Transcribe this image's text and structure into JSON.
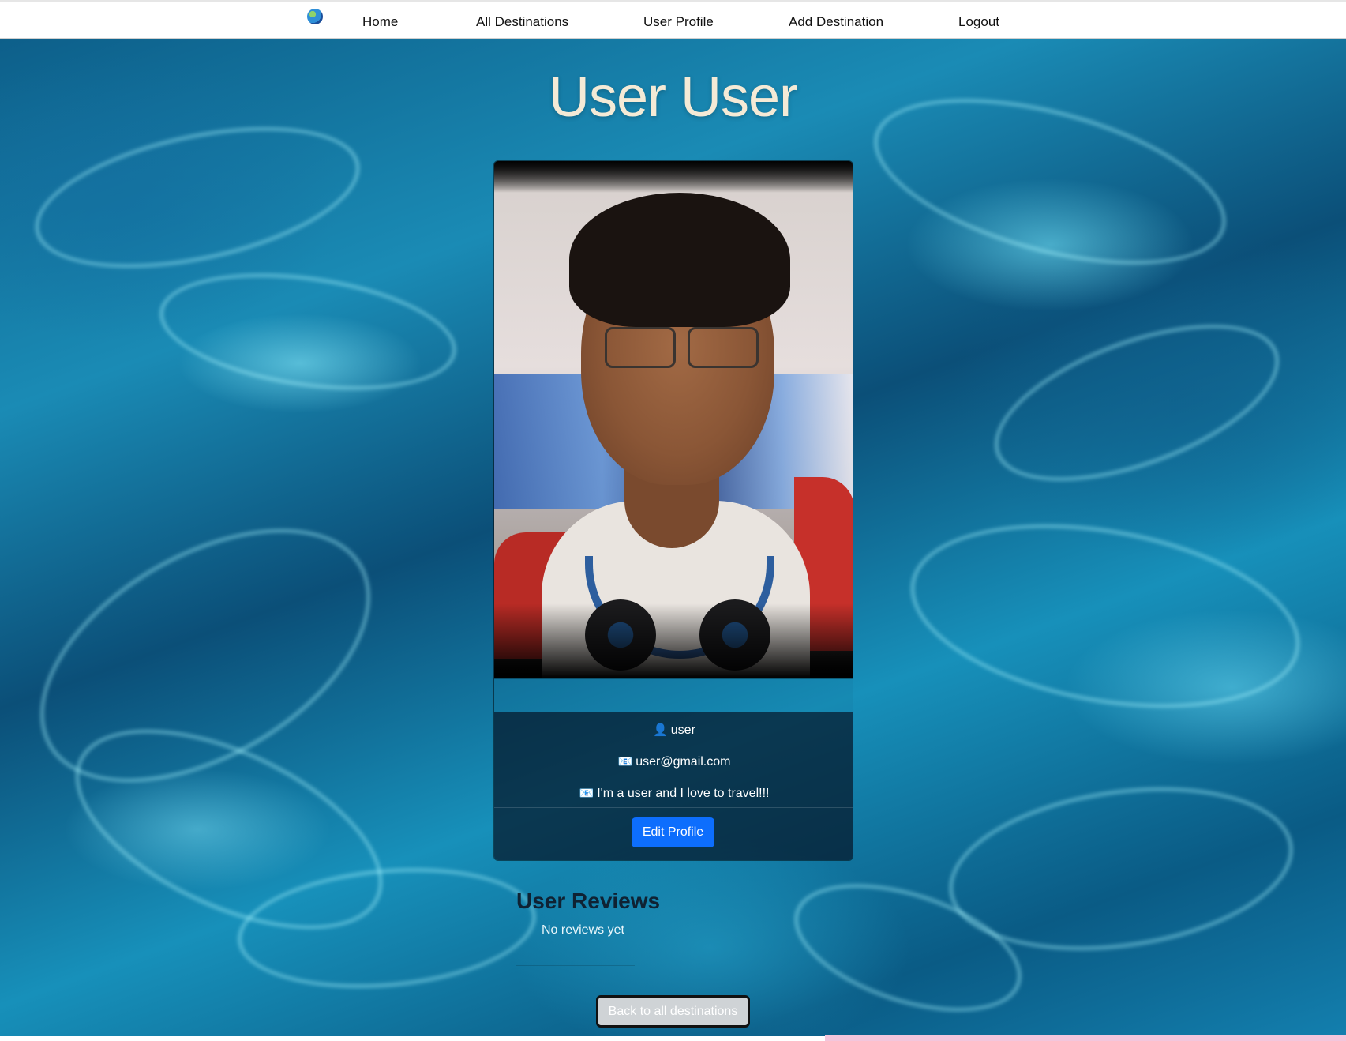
{
  "nav": {
    "logo_icon": "globe-icon",
    "links": [
      {
        "label": "Home"
      },
      {
        "label": "All Destinations"
      },
      {
        "label": "User Profile"
      },
      {
        "label": "Add Destination"
      },
      {
        "label": "Logout"
      }
    ]
  },
  "profile": {
    "title": "User User",
    "username_icon": "👤",
    "username": "user",
    "email_icon": "📧",
    "email": "user@gmail.com",
    "bio_icon": "📧",
    "bio": "I'm a user and I love to travel!!!",
    "edit_label": "Edit Profile"
  },
  "reviews": {
    "title": "User Reviews",
    "empty_text": "No reviews yet"
  },
  "footer": {
    "back_label": "Back to all destinations"
  },
  "colors": {
    "primary_button": "#0d6efd",
    "title_text": "#f4ead6"
  }
}
